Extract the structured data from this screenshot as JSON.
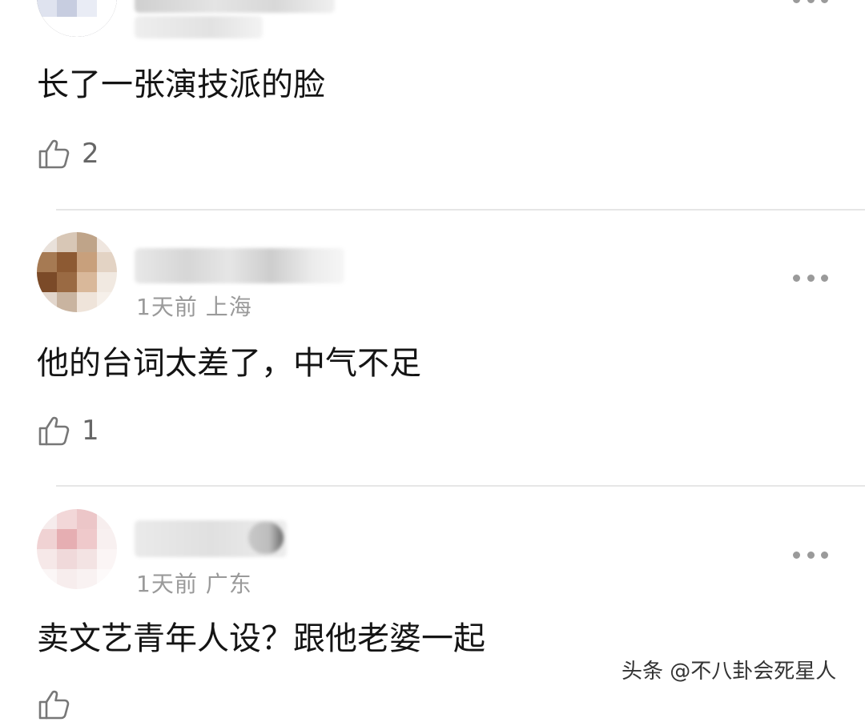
{
  "comments": [
    {
      "meta": "",
      "text": "长了一张演技派的脸",
      "likes": "2",
      "avatar_colors": [
        "#5a5a66",
        "#3c3c48",
        "#6c6c78",
        "#4a4a56"
      ]
    },
    {
      "meta": "1天前 上海",
      "text": "他的台词太差了，中气不足",
      "likes": "1",
      "avatar_colors": [
        "#e9e1da",
        "#d8c7b6",
        "#bfa489",
        "#efe6df",
        "#a67a53",
        "#8d5a33",
        "#c8a07c",
        "#e3d3c4",
        "#7b4a28",
        "#9a6a43",
        "#d9b89a",
        "#f1e9e1",
        "#e2d6cc",
        "#c9b4a0",
        "#efe4da",
        "#f6f0ea"
      ]
    },
    {
      "meta": "1天前 广东",
      "text": "卖文艺青年人设？跟他老婆一起",
      "likes": "",
      "avatar_colors": [
        "#f6ecec",
        "#f2d7d8",
        "#ecc6c8",
        "#f7eeee",
        "#f0d2d3",
        "#e6aeb2",
        "#efc9cb",
        "#f8f0f0",
        "#f6e8e8",
        "#f0d9da",
        "#f3e3e3",
        "#fbf5f5",
        "#fbf6f6",
        "#f7eded",
        "#f9f2f2",
        "#fdfafa"
      ]
    }
  ],
  "watermark": "头条 @不八卦会死星人",
  "colors": {
    "meta": "#9a9a9a",
    "divider": "#e6e6e6",
    "text": "#141414"
  },
  "icons": {
    "like": "thumbs-up-icon",
    "more": "more-dots-icon"
  }
}
